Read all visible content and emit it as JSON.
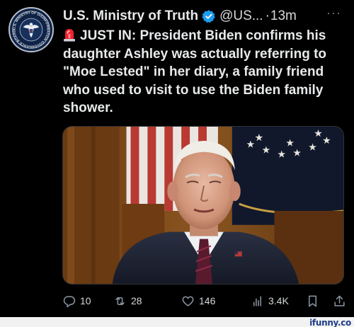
{
  "tweet": {
    "display_name": "U.S. Ministry of Truth",
    "handle": "@US...",
    "separator": "·",
    "time": "13m",
    "more_label": "···",
    "body": "JUST IN: President Biden confirms his daughter Ashley was actually referring to \"Moe Lested\" in her diary, a family friend who used to visit to use the Biden family shower.",
    "avatar": {
      "icon": "eagle-seal-icon",
      "ring_text": "U.S. MINISTRY OF DISINFORMATION GOVERNANCE BOARD"
    }
  },
  "actions": {
    "reply": {
      "icon": "reply-icon",
      "count": "10"
    },
    "retweet": {
      "icon": "retweet-icon",
      "count": "28"
    },
    "like": {
      "icon": "heart-icon",
      "count": "146"
    },
    "views": {
      "icon": "views-icon",
      "count": "3.4K"
    },
    "bookmark": {
      "icon": "bookmark-icon"
    },
    "share": {
      "icon": "share-icon"
    }
  },
  "watermark": "ifunny.co",
  "colors": {
    "background": "#000000",
    "text": "#e7e9ea",
    "muted": "#8b98a5",
    "verified": "#1d9bf0",
    "siren": "#f4212e",
    "watermark": "#1f3c88"
  }
}
